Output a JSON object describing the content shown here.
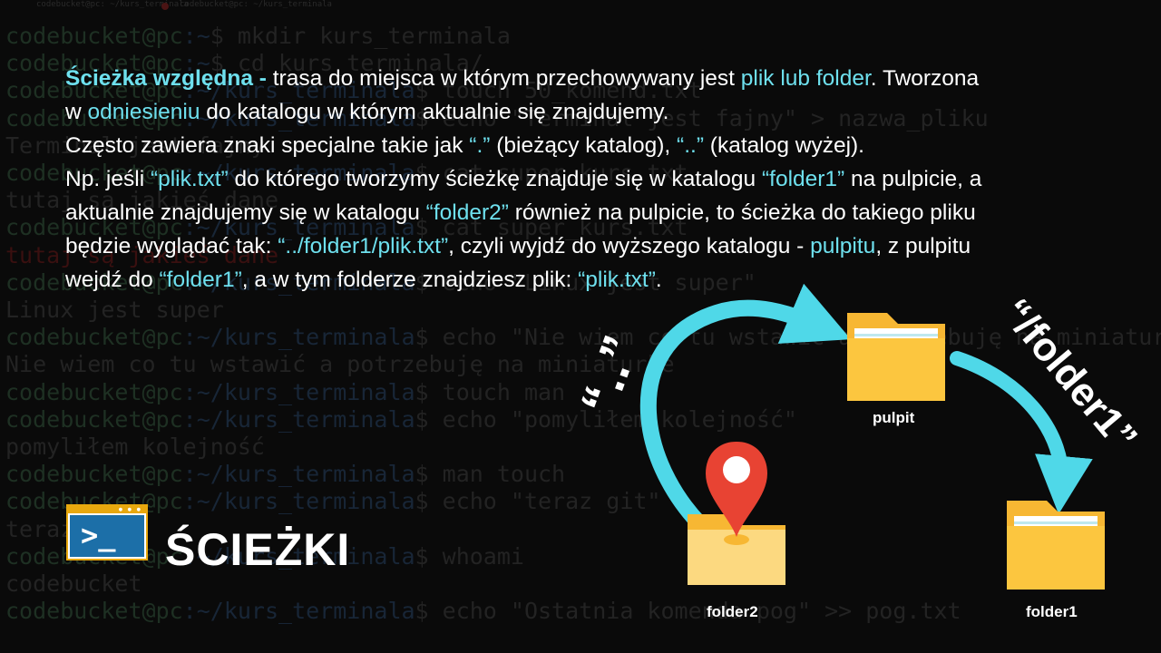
{
  "terminal": {
    "tabs": [
      "codebucket@pc: ~/kurs_terminala",
      "codebucket@pc: ~/kurs_terminala"
    ],
    "lines": [
      {
        "user": "codebucket@pc",
        "path": ":~",
        "cmd": "$ mkdir kurs_terminala"
      },
      {
        "user": "codebucket@pc",
        "path": ":~",
        "cmd": "$ cd kurs_terminala/"
      },
      {
        "user": "codebucket@pc",
        "path": ":~/kurs_terminala",
        "cmd": "$ touch 50_komend.txt"
      },
      {
        "user": "codebucket@pc",
        "path": ":~/kurs_terminala",
        "cmd": "$ echo \"Terminal jest fajny\" > nazwa_pliku"
      },
      {
        "out": "Terminal jest fajny"
      },
      {
        "user": "codebucket@pc",
        "path": ":~/kurs_terminala",
        "cmd": "$ cat super_kurs.txt"
      },
      {
        "out": "tutaj są jakieś dane"
      },
      {
        "user": "codebucket@pc",
        "path": ":~/kurs_terminala",
        "cmd": "$ cat super_kurs.txt"
      },
      {
        "err": "tutaj są jakieś dane"
      },
      {
        "user": "codebucket@pc",
        "path": ":~/kurs_terminala",
        "cmd": "$ echo \"Linux jest super\""
      },
      {
        "out": "Linux jest super"
      },
      {
        "user": "codebucket@pc",
        "path": ":~/kurs_terminala",
        "cmd": "$ echo \"Nie wiem co tu wstawić a potrzebuję na miniaturke\""
      },
      {
        "out": "Nie wiem co tu wstawić a potrzebuję na miniaturke"
      },
      {
        "user": "codebucket@pc",
        "path": ":~/kurs_terminala",
        "cmd": "$ touch man"
      },
      {
        "user": "codebucket@pc",
        "path": ":~/kurs_terminala",
        "cmd": "$ echo \"pomyliłem kolejność\""
      },
      {
        "out": "pomyliłem kolejność"
      },
      {
        "user": "codebucket@pc",
        "path": ":~/kurs_terminala",
        "cmd": "$ man touch"
      },
      {
        "user": "codebucket@pc",
        "path": ":~/kurs_terminala",
        "cmd": "$ echo \"teraz git\""
      },
      {
        "out": "teraz git"
      },
      {
        "user": "codebucket@pc",
        "path": ":~/kurs_terminala",
        "cmd": "$ whoami"
      },
      {
        "out": "codebucket"
      },
      {
        "user": "codebucket@pc",
        "path": ":~/kurs_terminala",
        "cmd": "$ echo \"Ostatnia komenda pog\" >> pog.txt"
      }
    ]
  },
  "paragraph": {
    "l1": {
      "a": "Ścieżka względna -",
      "b": " trasa do miejsca w którym przechowywany jest ",
      "c": "plik lub folder",
      "d": ". Tworzona"
    },
    "l2": {
      "a": "w ",
      "b": "odniesieniu",
      "c": " do katalogu w którym aktualnie się znajdujemy."
    },
    "l3": {
      "a": "Często zawiera znaki specjalne takie jak ",
      "b": "“.”",
      "c": " (bieżący katalog), ",
      "d": "“..”",
      "e": " (katalog wyżej)."
    },
    "l4": {
      "a": "Np. jeśli ",
      "b": "“plik.txt”",
      "c": " do którego tworzymy ścieżkę znajduje się w katalogu ",
      "d": "“folder1”",
      "e": " na pulpicie, a"
    },
    "l5": {
      "a": "aktualnie znajdujemy się w katalogu ",
      "b": "“folder2”",
      "c": " również na pulpicie, to ścieżka do takiego pliku"
    },
    "l6": {
      "a": "będzie wyglądać tak: ",
      "b": "“../folder1/plik.txt”",
      "c": ", czyli wyjdź do wyższego katalogu - ",
      "d": "pulpitu",
      "e": ", z pulpitu"
    },
    "l7": {
      "a": "wejdź do ",
      "b": "“folder1”",
      "c": ", a w tym folderze znajdziesz plik: ",
      "d": "“plik.txt”",
      "e": "."
    }
  },
  "title": "ŚCIEŻKI",
  "logo_prompt": ">_",
  "diagram": {
    "dotdot_label": "“..”",
    "folder1_path_label": "“/folder1”",
    "folders": {
      "pulpit": "pulpit",
      "folder2": "folder2",
      "folder1": "folder1"
    },
    "icons": [
      "terminal-icon",
      "folder-icon",
      "location-pin-icon",
      "arrow-icon"
    ]
  },
  "colors": {
    "accent": "#6ee0ee",
    "folder": "#f7b733",
    "folder_light": "#fcd980",
    "pin": "#e84333",
    "logo_frame": "#e8a80e",
    "logo_screen": "#1c6fa8"
  }
}
